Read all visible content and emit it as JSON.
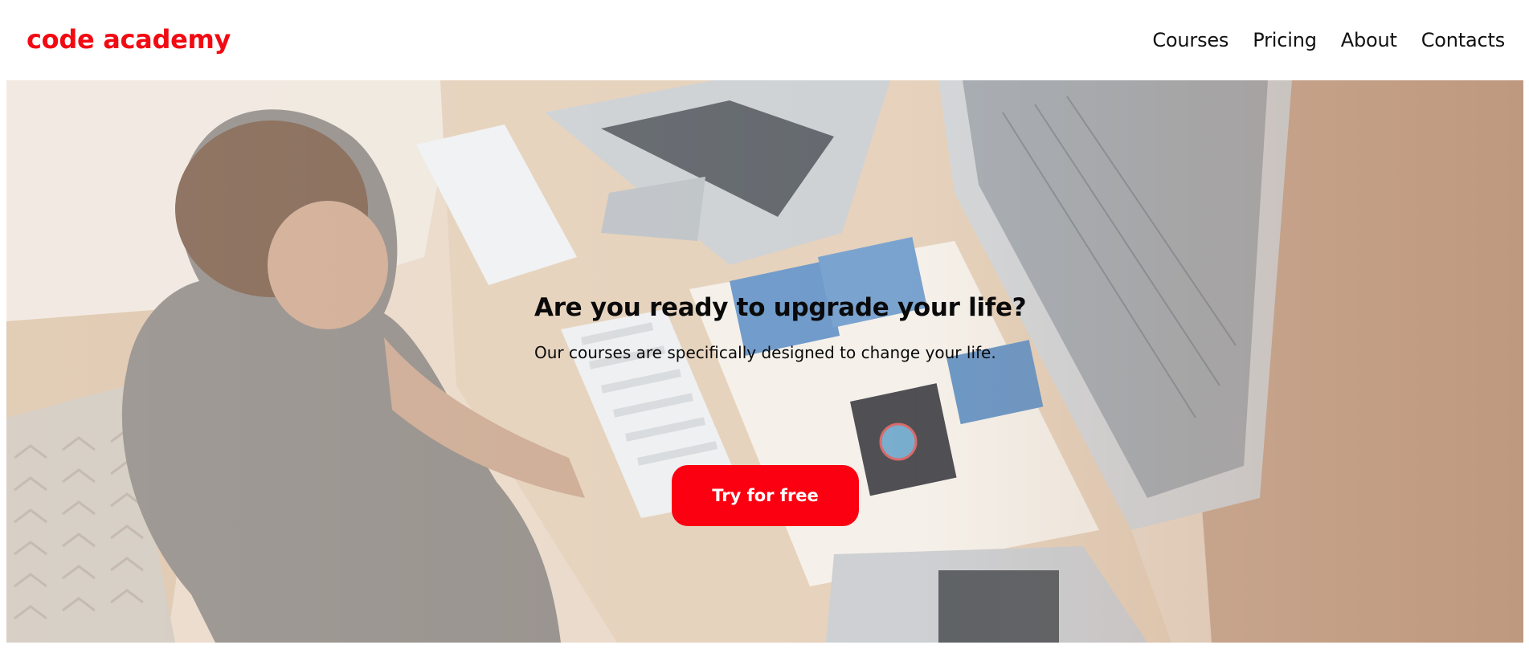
{
  "header": {
    "logo_text": "code academy",
    "nav": [
      {
        "label": "Courses"
      },
      {
        "label": "Pricing"
      },
      {
        "label": "About"
      },
      {
        "label": "Contacts"
      }
    ]
  },
  "hero": {
    "title": "Are you ready to upgrade your life?",
    "subtitle": "Our courses are specifically designed to change your life.",
    "cta_label": "Try for free",
    "image_subject": "person working at a desk with laptops, keyboards and notebooks (top-down photo)"
  },
  "colors": {
    "brand_red": "#f20a12",
    "cta_red": "#fa0011",
    "text_dark": "#0a0a0a"
  }
}
